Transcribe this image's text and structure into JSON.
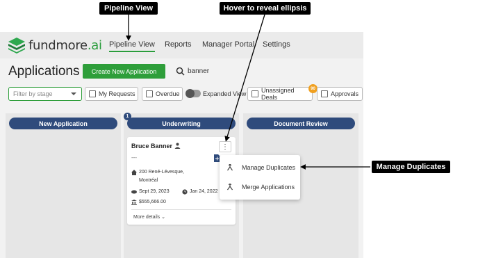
{
  "logo": {
    "name": "fundmore",
    "suffix": ".ai"
  },
  "nav": {
    "items": [
      {
        "label": "Pipeline View",
        "active": true
      },
      {
        "label": "Reports",
        "active": false
      },
      {
        "label": "Manager Portal",
        "active": false
      },
      {
        "label": "Settings",
        "active": false
      }
    ]
  },
  "page": {
    "title": "Applications"
  },
  "toolbar": {
    "create_label": "Create New Application",
    "search_value": "banner"
  },
  "filters": {
    "stage_placeholder": "Filter by stage",
    "my_requests": "My Requests",
    "overdue": "Overdue",
    "expanded_view": "Expanded View",
    "unassigned_deals": "Unassigned Deals",
    "unassigned_count": "90",
    "approvals": "Approvals"
  },
  "columns": [
    {
      "title": "New Application"
    },
    {
      "title": "Underwriting",
      "count": "1"
    },
    {
      "title": "Document Review"
    }
  ],
  "card": {
    "name": "Bruce Banner",
    "dash": "---",
    "address_line1": "200 René-Lévesque,",
    "address_line2": "Montréal",
    "date_start": "Sept 29, 2023",
    "date_end": "Jan 24, 2022",
    "amount": "$555,666.00",
    "more_details": "More details"
  },
  "menu": {
    "ellipsis": "⋮",
    "items": [
      {
        "label": "Manage Duplicates",
        "icon": "merge-icon"
      },
      {
        "label": "Merge Applications",
        "icon": "merge-icon"
      }
    ]
  },
  "callouts": {
    "pipeline": "Pipeline View",
    "hover": "Hover to reveal ellipsis",
    "manage": "Manage Duplicates"
  },
  "colors": {
    "brand_green": "#2e9e3a",
    "column_header": "#2f4b7c",
    "badge_orange": "#f0a020"
  }
}
